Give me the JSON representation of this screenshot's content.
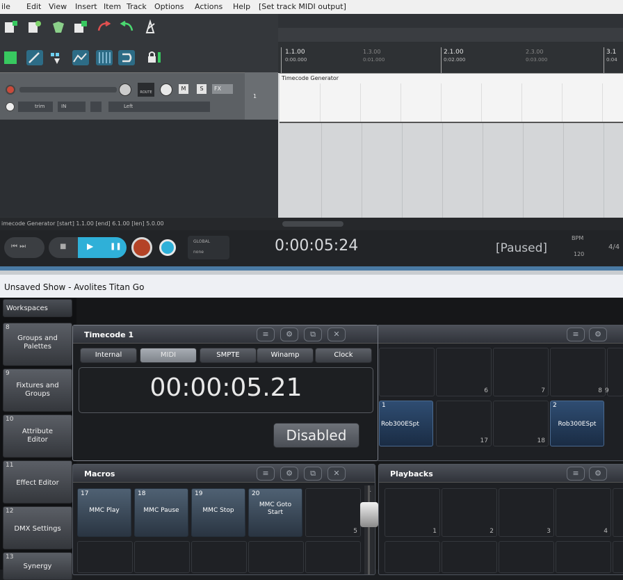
{
  "reaper": {
    "menu": [
      "ile",
      "Edit",
      "View",
      "Insert",
      "Item",
      "Track",
      "Options",
      "Actions",
      "Help",
      "[Set track MIDI output]"
    ],
    "track": {
      "route_label": "ROUTE",
      "m_label": "M",
      "s_label": "S",
      "fx_label": "FX",
      "trim_label": "trim",
      "in_label": "IN",
      "pan_label": "Left",
      "track_number": "1"
    },
    "ruler": {
      "marks": [
        {
          "bar": "1.1.00",
          "time": "0:00.000"
        },
        {
          "bar": "1.3.00",
          "time": "0:01.000"
        },
        {
          "bar": "2.1.00",
          "time": "0:02.000"
        },
        {
          "bar": "2.3.00",
          "time": "0:03.000"
        },
        {
          "bar": "3.1",
          "time": "0:04"
        }
      ]
    },
    "item_name": "Timecode Generator",
    "status_line": "imecode Generator [start] 1.1.00 [end] 6.1.00 [len] 5.0.00",
    "transport": {
      "global_label": "GLOBAL",
      "global_value": "none",
      "time": "0:00:05:24",
      "state": "[Paused]",
      "bpm_label": "BPM",
      "bpm_value": "120",
      "time_sig": "4/4"
    }
  },
  "titan": {
    "window_title": "Unsaved Show - Avolites Titan Go",
    "sidebar": [
      {
        "num": "",
        "label": "Workspaces"
      },
      {
        "num": "8",
        "label": "Groups and Palettes"
      },
      {
        "num": "9",
        "label": "Fixtures and Groups"
      },
      {
        "num": "10",
        "label": "Attribute Editor"
      },
      {
        "num": "11",
        "label": "Effect Editor"
      },
      {
        "num": "12",
        "label": "DMX Settings"
      },
      {
        "num": "13",
        "label": "Synergy"
      }
    ],
    "timecode": {
      "title": "Timecode 1",
      "sources": [
        "Internal",
        "MIDI",
        "SMPTE",
        "Winamp",
        "Clock"
      ],
      "selected_source": "MIDI",
      "value": "00:00:05.21",
      "status": "Disabled"
    },
    "right_grid": {
      "row1_numbers": [
        "6",
        "7",
        "8",
        "9"
      ],
      "row2": [
        {
          "num": "1",
          "label": "Rob300ESpt"
        },
        {
          "num": "17",
          "label": ""
        },
        {
          "num": "18",
          "label": ""
        },
        {
          "num": "2",
          "label": "Rob300ESpt"
        }
      ]
    },
    "macros": {
      "title": "Macros",
      "items": [
        {
          "num": "17",
          "label": "MMC Play"
        },
        {
          "num": "18",
          "label": "MMC Pause"
        },
        {
          "num": "19",
          "label": "MMC Stop"
        },
        {
          "num": "20",
          "label": "MMC Goto Start"
        }
      ],
      "empty_num": "5",
      "fader_num": "1"
    },
    "playbacks": {
      "title": "Playbacks",
      "numbers": [
        "1",
        "2",
        "3",
        "4"
      ]
    },
    "icons": {
      "menu": "≡",
      "gear": "⚙",
      "window": "⧉",
      "close": "✕"
    }
  }
}
